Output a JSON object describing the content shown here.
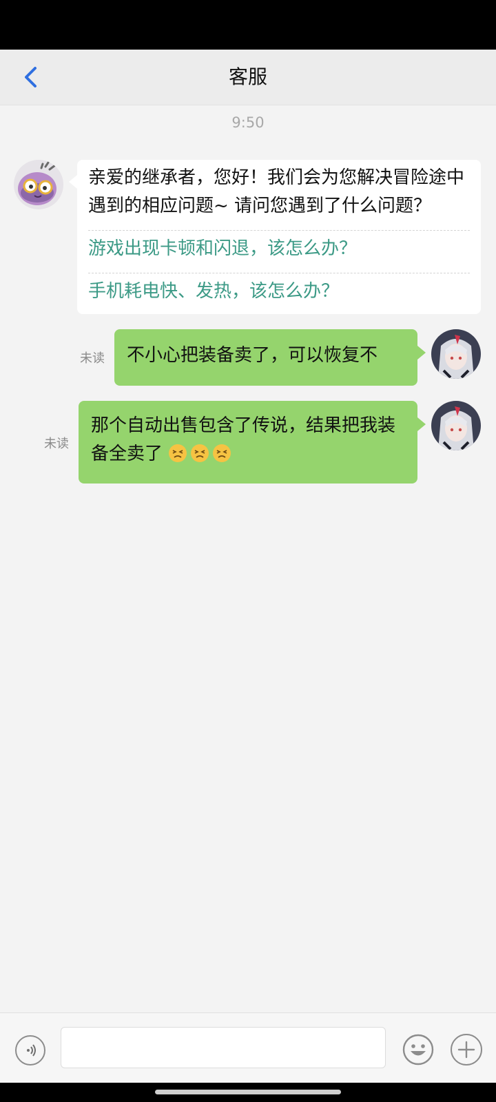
{
  "header": {
    "title": "客服"
  },
  "chat": {
    "timestamp": "9:50",
    "bot_message": {
      "text": "亲爱的继承者，您好！我们会为您解决冒险途中遇到的相应问题~ 请问您遇到了什么问题？",
      "faq": [
        "游戏出现卡顿和闪退，该怎么办？",
        "手机耗电快、发热，该怎么办？"
      ]
    },
    "user_messages": [
      {
        "text": "不小心把装备卖了，可以恢复不",
        "status": "未读"
      },
      {
        "text": "那个自动出售包含了传说，结果把我装备全卖了",
        "status": "未读",
        "emoji": [
          "persevering-face",
          "persevering-face",
          "persevering-face"
        ]
      }
    ]
  },
  "input": {
    "value": "",
    "placeholder": ""
  },
  "colors": {
    "user_bubble": "#95d46d",
    "faq_link": "#3c9a86",
    "back_arrow": "#2f6fe0",
    "background": "#f3f3f3"
  }
}
